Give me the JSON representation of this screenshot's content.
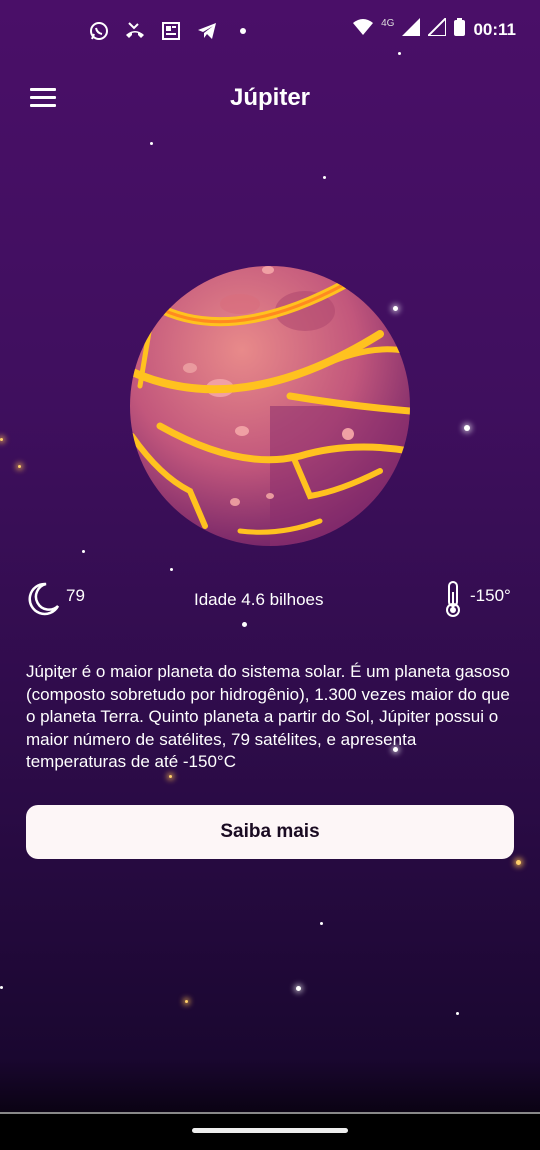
{
  "status_bar": {
    "time": "00:11",
    "network": "4G",
    "left_icons": [
      "whatsapp-icon",
      "phone-missed-icon",
      "news-icon",
      "telegram-icon",
      "dot-icon"
    ],
    "right_icons": [
      "wifi-icon",
      "signal-icon",
      "signal-icon",
      "battery-icon"
    ]
  },
  "header": {
    "title": "Júpiter",
    "menu_icon": "hamburger-menu-icon"
  },
  "planet": {
    "image": "jupiter-illustration",
    "colors": {
      "body": "#c2577c",
      "lava": "#ffc21f"
    }
  },
  "stats": {
    "moons": "79",
    "age": "Idade  4.6 bilhoes",
    "temperature": "-150°"
  },
  "description": "Júpiter é o maior planeta do sistema solar. É um planeta gasoso (composto sobretudo por hidrogênio), 1.300 vezes maior do que o planeta Terra. Quinto planeta a partir do Sol, Júpiter possui o maior número de satélites, 79 satélites, e apresenta temperaturas de até -150°C",
  "cta": {
    "label": "Saiba mais"
  },
  "theme": {
    "background": "#3f0f5e",
    "button_bg": "#fdf6f7"
  }
}
